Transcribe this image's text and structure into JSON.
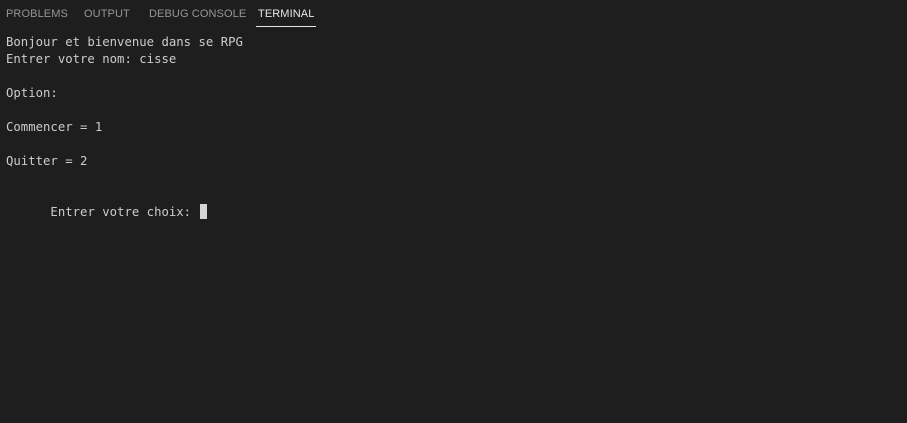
{
  "tabs": [
    {
      "label": "PROBLEMS",
      "active": false
    },
    {
      "label": "OUTPUT",
      "active": false
    },
    {
      "label": "DEBUG CONSOLE",
      "active": false
    },
    {
      "label": "TERMINAL",
      "active": true
    }
  ],
  "terminal": {
    "lines": [
      "Bonjour et bienvenue dans se RPG",
      "Entrer votre nom: cisse",
      "",
      "Option:",
      "",
      "Commencer = 1",
      "",
      "Quitter = 2",
      "",
      "Entrer votre choix: "
    ]
  },
  "colors": {
    "background": "#1e1e1e",
    "tab_inactive": "#969696",
    "tab_active": "#e7e7e7",
    "terminal_text": "#cccccc",
    "cursor": "#d4d4d4"
  }
}
